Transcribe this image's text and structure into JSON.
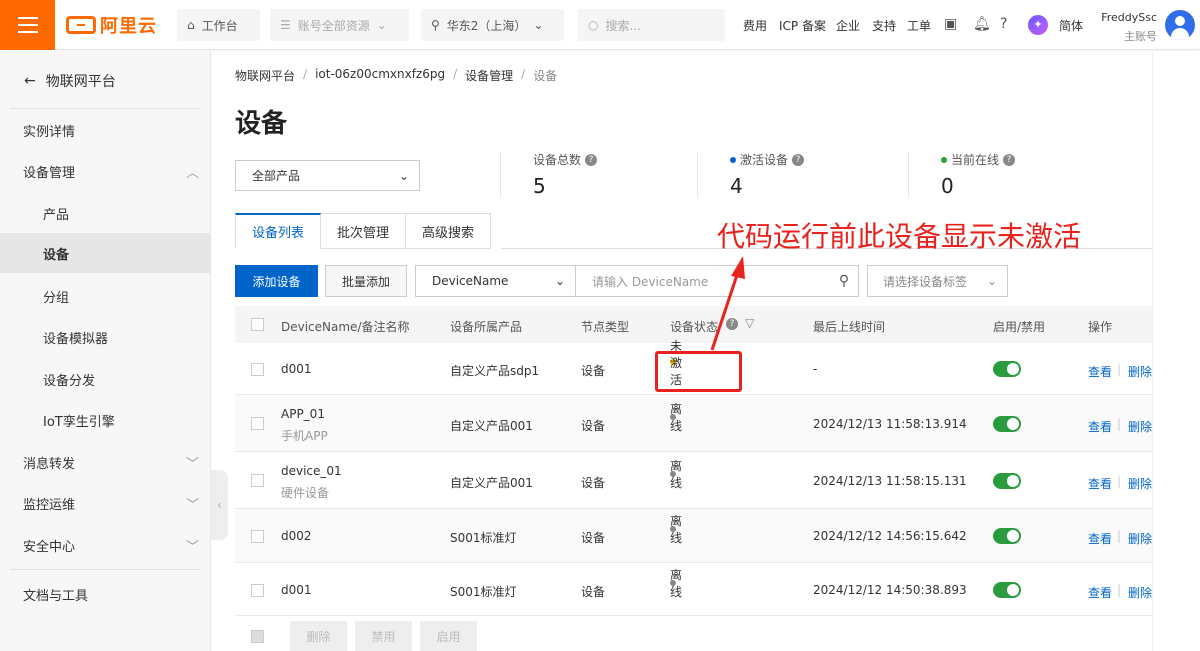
{
  "topbar": {
    "logo": "阿里云",
    "workbench": "工作台",
    "resources": "账号全部资源",
    "region": "华东2（上海）",
    "search_placeholder": "搜索...",
    "links": [
      "费用",
      "ICP 备案",
      "企业",
      "支持",
      "工单"
    ],
    "lang": "简体",
    "user_name": "FreddySsc",
    "user_role": "主账号"
  },
  "sidebar": {
    "back_label": "物联网平台",
    "items": [
      {
        "label": "实例详情"
      },
      {
        "label": "设备管理"
      },
      {
        "label": "产品"
      },
      {
        "label": "设备"
      },
      {
        "label": "分组"
      },
      {
        "label": "设备模拟器"
      },
      {
        "label": "设备分发"
      },
      {
        "label": "IoT孪生引擎"
      },
      {
        "label": "消息转发"
      },
      {
        "label": "监控运维"
      },
      {
        "label": "安全中心"
      },
      {
        "label": "文档与工具"
      }
    ]
  },
  "breadcrumb": [
    "物联网平台",
    "iot-06z00cmxnxfz6pg",
    "设备管理",
    "设备"
  ],
  "page_title": "设备",
  "product_filter": "全部产品",
  "stats": {
    "total_label": "设备总数",
    "total_value": "5",
    "active_label": "激活设备",
    "active_value": "4",
    "online_label": "当前在线",
    "online_value": "0",
    "active_color": "#0064c8",
    "online_color": "#2b9c3e"
  },
  "tabs": [
    "设备列表",
    "批次管理",
    "高级搜索"
  ],
  "toolbar": {
    "add_label": "添加设备",
    "batch_label": "批量添加",
    "field_select": "DeviceName",
    "search_placeholder": "请输入 DeviceName",
    "tag_placeholder": "请选择设备标签"
  },
  "table": {
    "headers": [
      "DeviceName/备注名称",
      "设备所属产品",
      "节点类型",
      "设备状态",
      "最后上线时间",
      "启用/禁用",
      "操作"
    ],
    "rows": [
      {
        "name": "d001",
        "note": "",
        "product": "自定义产品sdp1",
        "node": "设备",
        "status": "未激活",
        "last_online": "-",
        "view": "查看",
        "del": "删除"
      },
      {
        "name": "APP_01",
        "note": "手机APP",
        "product": "自定义产品001",
        "node": "设备",
        "status": "离线",
        "last_online": "2024/12/13 11:58:13.914",
        "view": "查看",
        "del": "删除"
      },
      {
        "name": "device_01",
        "note": "硬件设备",
        "product": "自定义产品001",
        "node": "设备",
        "status": "离线",
        "last_online": "2024/12/13 11:58:15.131",
        "view": "查看",
        "del": "删除"
      },
      {
        "name": "d002",
        "note": "",
        "product": "S001标准灯",
        "node": "设备",
        "status": "离线",
        "last_online": "2024/12/12 14:56:15.642",
        "view": "查看",
        "del": "删除"
      },
      {
        "name": "d001",
        "note": "",
        "product": "S001标准灯",
        "node": "设备",
        "status": "离线",
        "last_online": "2024/12/12 14:50:38.893",
        "view": "查看",
        "del": "删除"
      }
    ],
    "status_colors": {
      "未激活": "#f5b400",
      "离线": "#888888"
    }
  },
  "footer_buttons": [
    "删除",
    "禁用",
    "启用"
  ],
  "annotation": "代码运行前此设备显示未激活",
  "annotation_color": "#e8231d"
}
